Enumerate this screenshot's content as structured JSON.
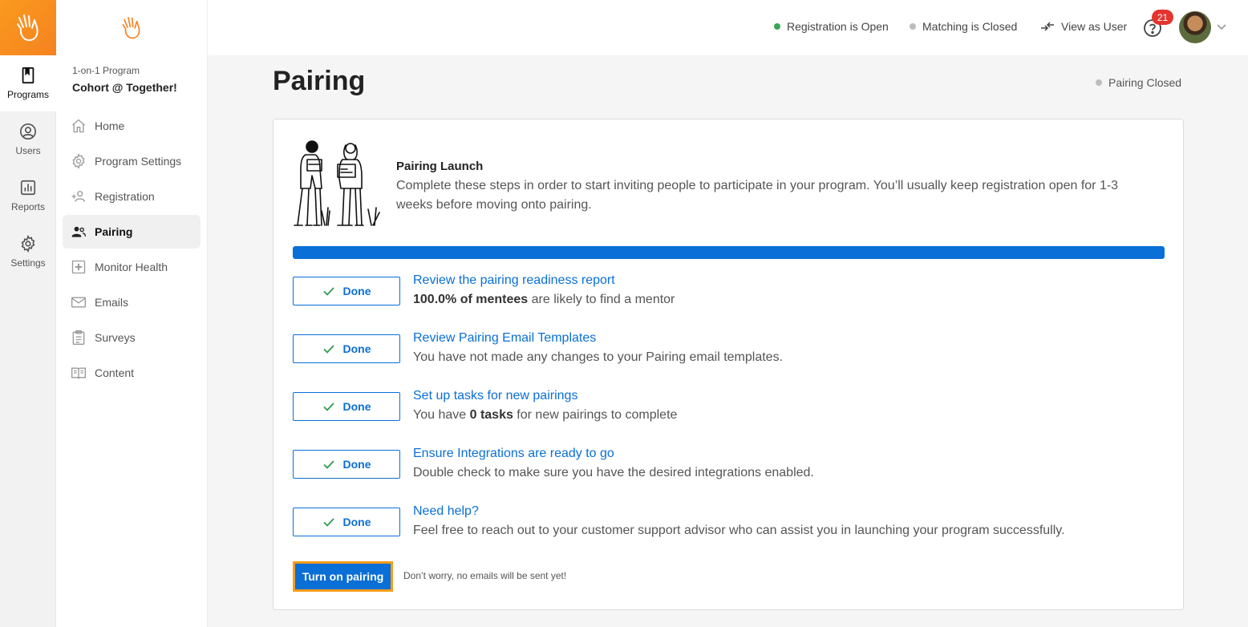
{
  "rail": {
    "items": [
      {
        "label": "Programs",
        "icon": "bookmark-icon",
        "active": true
      },
      {
        "label": "Users",
        "icon": "user-circle-icon",
        "active": false
      },
      {
        "label": "Reports",
        "icon": "bar-chart-icon",
        "active": false
      },
      {
        "label": "Settings",
        "icon": "gear-icon",
        "active": false
      }
    ]
  },
  "program": {
    "type": "1-on-1 Program",
    "name": "Cohort @ Together!"
  },
  "nav": {
    "items": [
      {
        "label": "Home",
        "icon": "home-icon"
      },
      {
        "label": "Program Settings",
        "icon": "gear-icon"
      },
      {
        "label": "Registration",
        "icon": "add-user-icon"
      },
      {
        "label": "Pairing",
        "icon": "people-icon",
        "active": true
      },
      {
        "label": "Monitor Health",
        "icon": "plus-square-icon"
      },
      {
        "label": "Emails",
        "icon": "envelope-icon"
      },
      {
        "label": "Surveys",
        "icon": "clipboard-icon"
      },
      {
        "label": "Content",
        "icon": "book-icon"
      }
    ]
  },
  "topbar": {
    "registration_status": "Registration is Open",
    "matching_status": "Matching is Closed",
    "view_as_user": "View as User",
    "notification_count": "21"
  },
  "page": {
    "title": "Pairing",
    "status": "Pairing Closed"
  },
  "launch": {
    "title": "Pairing Launch",
    "description": "Complete these steps in order to start inviting people to participate in your program. You’ll usually keep registration open for 1-3 weeks before moving onto pairing.",
    "progress": 1.0
  },
  "steps": [
    {
      "button": "Done",
      "title": "Review the pairing readiness report",
      "desc_bold": "100.0% of mentees",
      "desc_rest": " are likely to find a mentor"
    },
    {
      "button": "Done",
      "title": "Review Pairing Email Templates",
      "desc_pre": "You have not made any changes to your Pairing email templates."
    },
    {
      "button": "Done",
      "title": "Set up tasks for new pairings",
      "desc_pre": "You have ",
      "desc_bold": "0 tasks",
      "desc_rest": " for new pairings to complete"
    },
    {
      "button": "Done",
      "title": "Ensure Integrations are ready to go",
      "desc_pre": "Double check to make sure you have the desired integrations enabled."
    },
    {
      "button": "Done",
      "title": "Need help?",
      "desc_pre": "Feel free to reach out to your customer support advisor who can assist you in launching your program successfully."
    }
  ],
  "actions": {
    "turn_on": "Turn on pairing",
    "note": "Don’t worry, no emails will be sent yet!"
  },
  "colors": {
    "brand_orange": "#f58220",
    "primary_blue": "#0a6fd6",
    "open_green": "#3aa655",
    "closed_gray": "#bdbdbd",
    "badge_red": "#e3342f"
  }
}
